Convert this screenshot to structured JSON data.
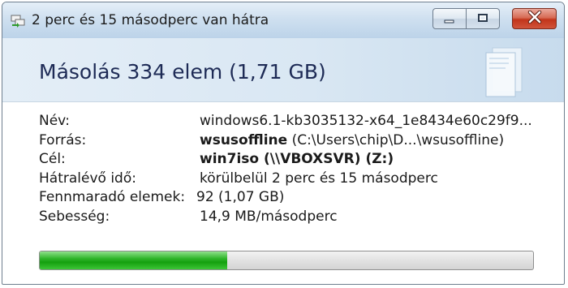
{
  "window": {
    "title": "2 perc és 15 másodperc van hátra"
  },
  "header": {
    "title": "Másolás 334 elem (1,71 GB)"
  },
  "details": {
    "name_label": "Név:",
    "name_value": "windows6.1-kb3035132-x64_1e8434e60c29f9...",
    "source_label": "Forrás:",
    "source_bold": "wsusoffline",
    "source_path": " (C:\\Users\\chip\\D...\\wsusoffline)",
    "dest_label": "Cél:",
    "dest_value": "win7iso (\\\\VBOXSVR) (Z:)",
    "time_label": "Hátralévő idő:",
    "time_value": "körülbelül 2 perc és 15 másodperc",
    "remaining_label": "Fennmaradó elemek:",
    "remaining_value": "92 (1,07 GB)",
    "speed_label": "Sebesség:",
    "speed_value": "14,9 MB/másodperc"
  },
  "progress": {
    "fraction": 0.38,
    "fill_color": "#2fb52a"
  },
  "icons": {
    "title": "copy-files-icon",
    "minimize": "minimize-icon",
    "maximize": "maximize-icon",
    "close": "close-icon",
    "header": "document-stack-icon"
  }
}
